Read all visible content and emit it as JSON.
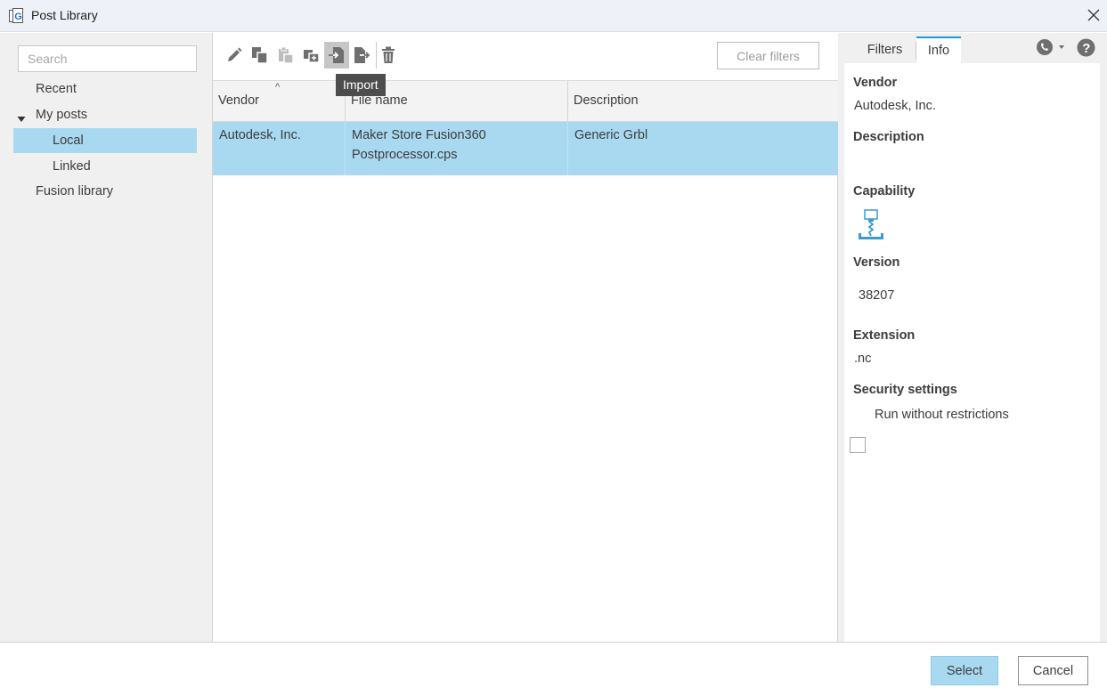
{
  "window": {
    "title": "Post Library",
    "close_icon": "close-icon"
  },
  "sidebar": {
    "search_placeholder": "Search",
    "items": [
      {
        "label": "Recent"
      },
      {
        "label": "My posts"
      },
      {
        "label": "Local",
        "selected": true
      },
      {
        "label": "Linked"
      },
      {
        "label": "Fusion library"
      }
    ]
  },
  "toolbar": {
    "buttons": [
      "pencil-icon",
      "copy-icon",
      "paste-icon",
      "duplicate-icon",
      "import-icon",
      "export-icon",
      "trash-icon"
    ],
    "active_button": "import-icon",
    "tooltip": "Import",
    "clear_filters": "Clear filters"
  },
  "table": {
    "columns": [
      "Vendor",
      "File name",
      "Description"
    ],
    "sorted_column": "Vendor",
    "rows": [
      {
        "vendor": "Autodesk, Inc.",
        "file_name_line1": "Maker Store Fusion360",
        "file_name_line2": "Postprocessor.cps",
        "description": "Generic Grbl"
      }
    ]
  },
  "info_panel": {
    "tabs": [
      "Filters",
      "Info"
    ],
    "active_tab": "Info",
    "vendor_label": "Vendor",
    "vendor_value": "Autodesk, Inc.",
    "description_label": "Description",
    "capability_label": "Capability",
    "capability_icon": "milling-icon",
    "version_label": "Version",
    "version_value": "38207",
    "extension_label": "Extension",
    "extension_value": ".nc",
    "security_label": "Security settings",
    "run_without_restrictions": "Run without restrictions",
    "run_without_restrictions_checked": false
  },
  "footer": {
    "select": "Select",
    "cancel": "Cancel"
  },
  "colors": {
    "selection": "#a8d9f0",
    "accent": "#1a9bd6",
    "tooltip_bg": "#4d4d4d"
  }
}
